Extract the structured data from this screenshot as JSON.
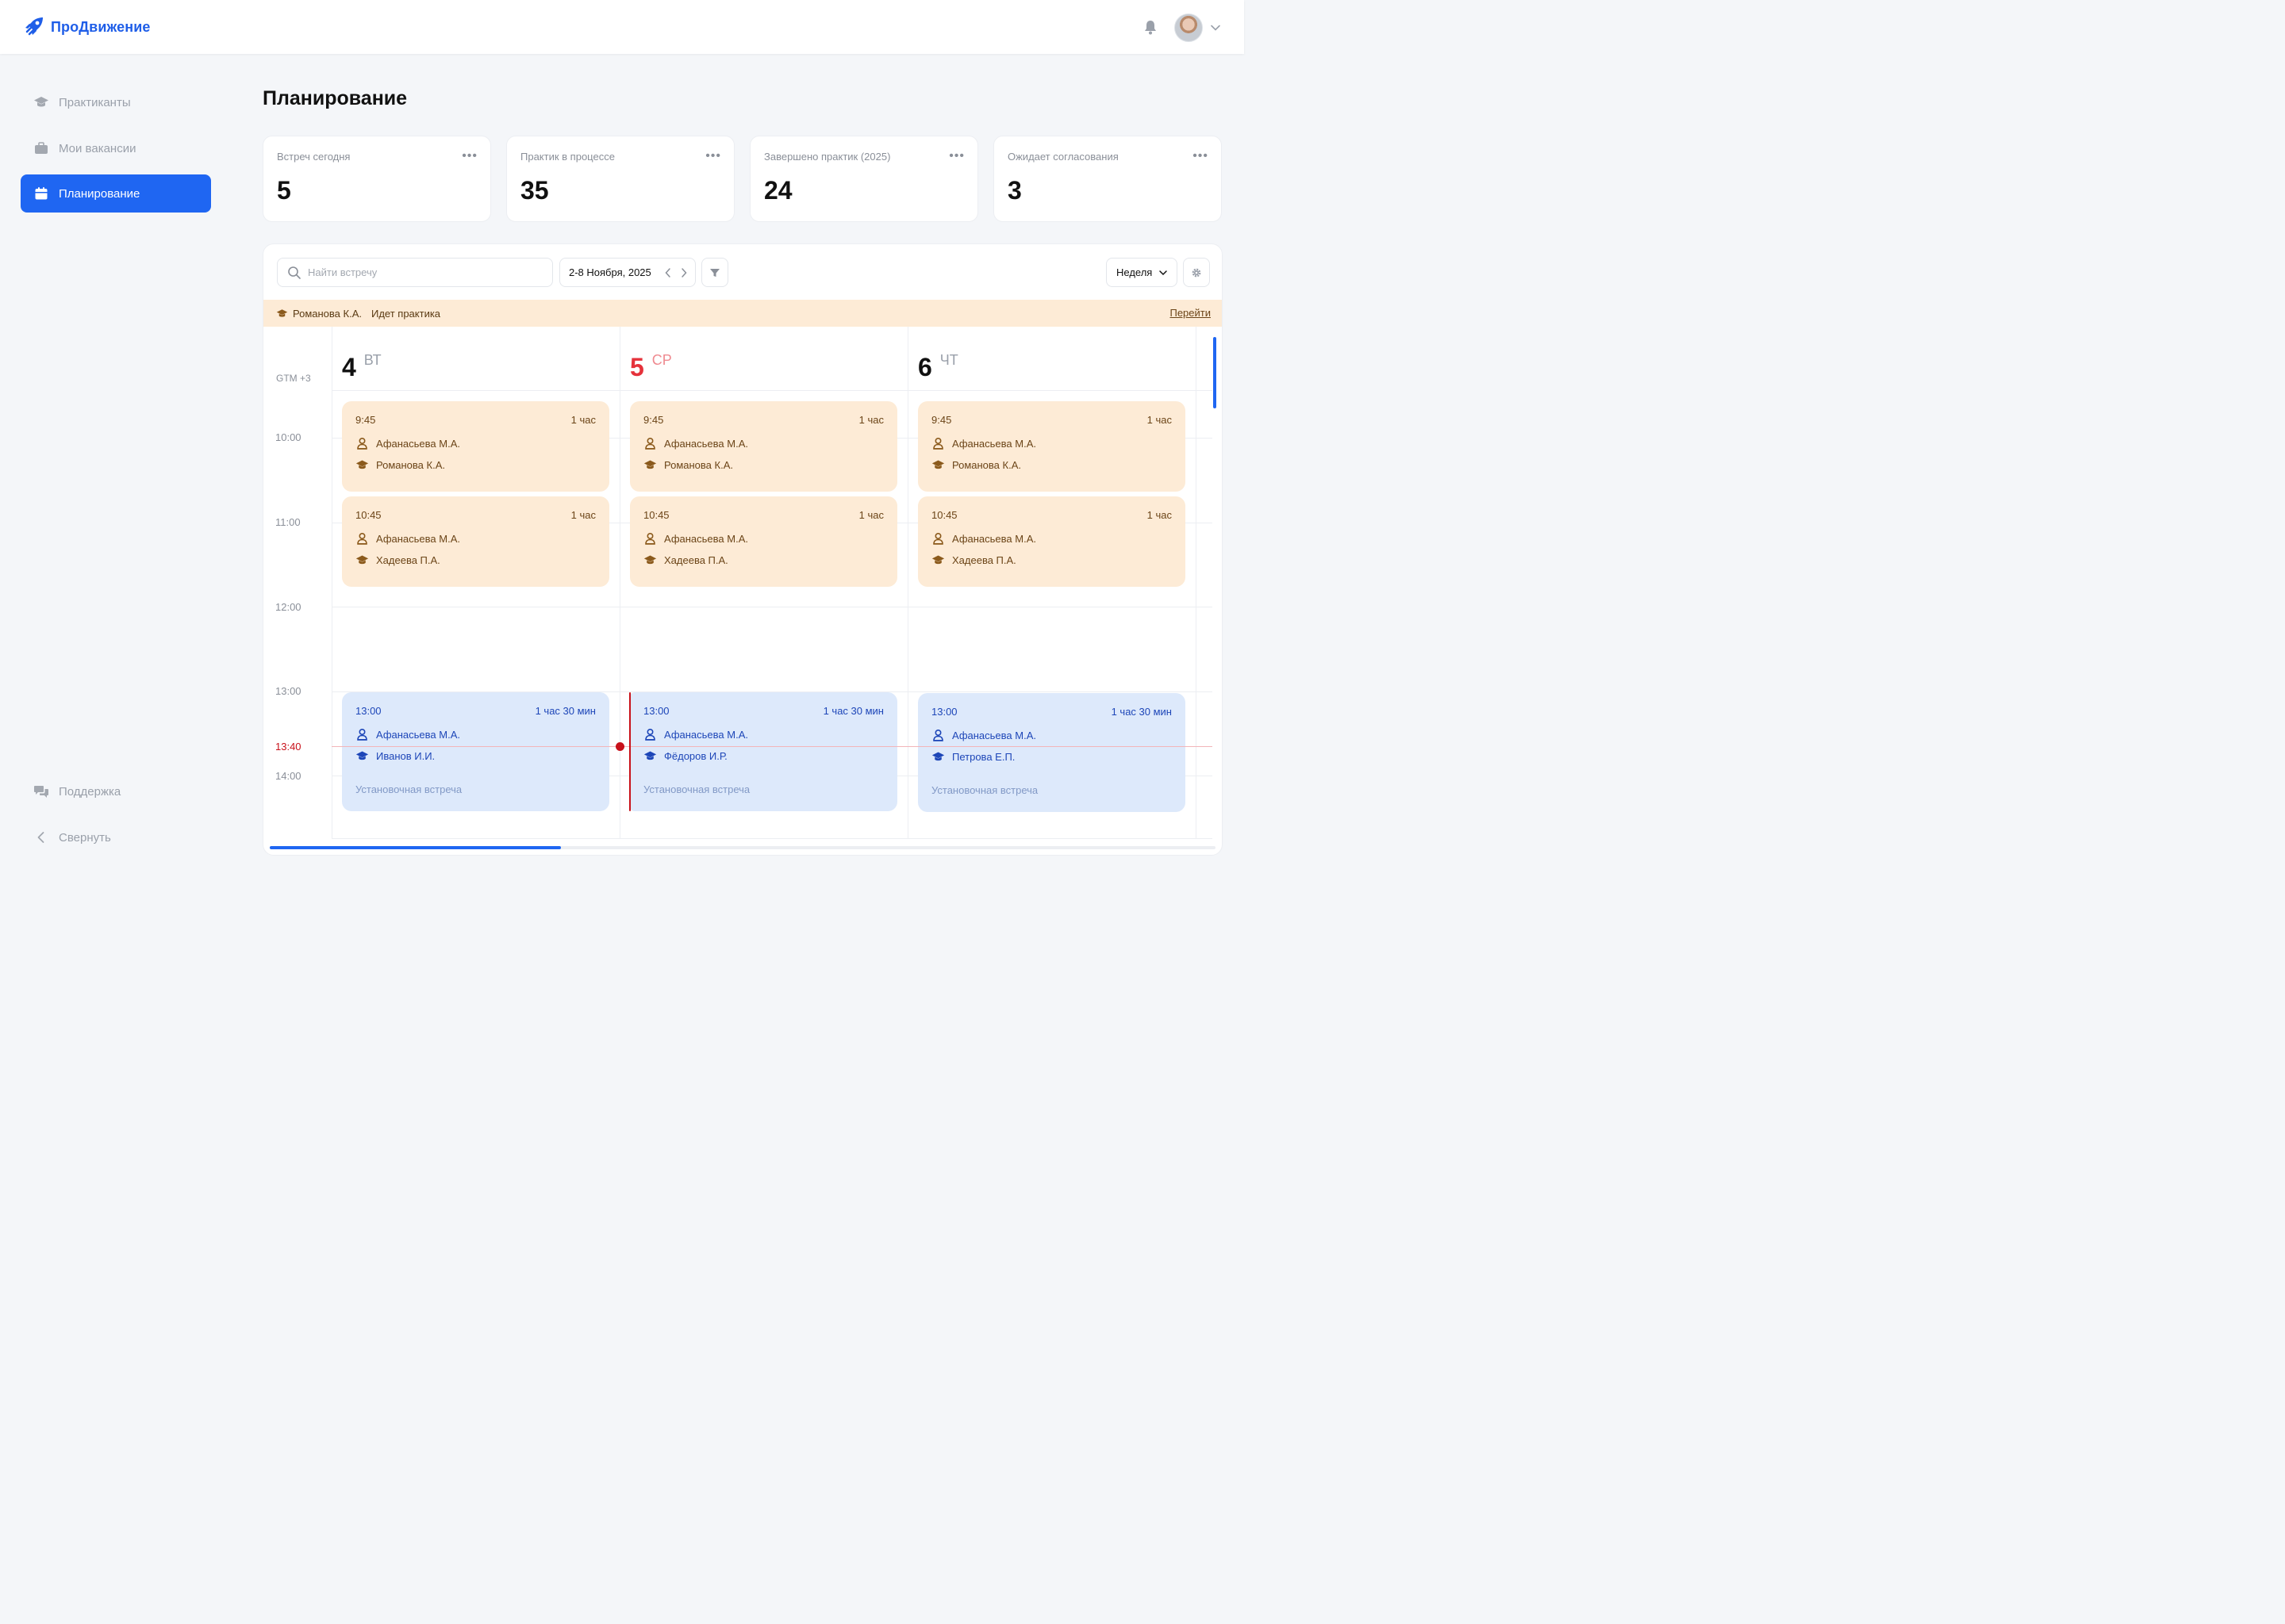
{
  "app": {
    "name": "ПроДвижение",
    "brand_color": "#1f5ee8"
  },
  "sidebar": {
    "items": [
      {
        "label": "Практиканты",
        "icon": "graduation-cap-icon"
      },
      {
        "label": "Мои вакансии",
        "icon": "briefcase-icon"
      },
      {
        "label": "Планирование",
        "icon": "calendar-icon",
        "active": true
      }
    ],
    "support_label": "Поддержка",
    "collapse_label": "Свернуть"
  },
  "page": {
    "title": "Планирование"
  },
  "stats": [
    {
      "label": "Встреч сегодня",
      "value": "5"
    },
    {
      "label": "Практик в процессе",
      "value": "35"
    },
    {
      "label": "Завершено практик (2025)",
      "value": "24"
    },
    {
      "label": "Ожидает согласования",
      "value": "3"
    }
  ],
  "toolbar": {
    "search_placeholder": "Найти встречу",
    "date_range": "2-8 Ноября, 2025",
    "view": "Неделя"
  },
  "banner": {
    "name": "Романова К.А.",
    "status": "Идет практика",
    "link": "Перейти"
  },
  "calendar": {
    "timezone": "GTM +3",
    "times": [
      "10:00",
      "11:00",
      "12:00",
      "13:00",
      "14:00"
    ],
    "now": "13:40",
    "days": [
      {
        "num": "4",
        "wd": "ВТ"
      },
      {
        "num": "5",
        "wd": "СР",
        "today": true
      },
      {
        "num": "6",
        "wd": "ЧТ"
      }
    ],
    "events": [
      [
        {
          "time": "9:45",
          "duration": "1 час",
          "mentor": "Афанасьева М.А.",
          "intern": "Романова К.А."
        },
        {
          "time": "10:45",
          "duration": "1 час",
          "mentor": "Афанасьева М.А.",
          "intern": "Хадеева П.А."
        },
        {
          "time": "13:00",
          "duration": "1 час 30 мин",
          "mentor": "Афанасьева М.А.",
          "intern": "Иванов И.И.",
          "note": "Установочная встреча"
        }
      ],
      [
        {
          "time": "9:45",
          "duration": "1 час",
          "mentor": "Афанасьева М.А.",
          "intern": "Романова К.А."
        },
        {
          "time": "10:45",
          "duration": "1 час",
          "mentor": "Афанасьева М.А.",
          "intern": "Хадеева П.А."
        },
        {
          "time": "13:00",
          "duration": "1 час 30 мин",
          "mentor": "Афанасьева М.А.",
          "intern": "Фёдоров И.Р.",
          "note": "Установочная встреча"
        }
      ],
      [
        {
          "time": "9:45",
          "duration": "1 час",
          "mentor": "Афанасьева М.А.",
          "intern": "Романова К.А."
        },
        {
          "time": "10:45",
          "duration": "1 час",
          "mentor": "Афанасьева М.А.",
          "intern": "Хадеева П.А."
        },
        {
          "time": "13:00",
          "duration": "1 час 30 мин",
          "mentor": "Афанасьева М.А.",
          "intern": "Петрова Е.П.",
          "note": "Установочная встреча"
        }
      ]
    ]
  },
  "colors": {
    "active": "#1f66f2",
    "today": "#e5323b",
    "now_line": "#c8111a",
    "orange_event": "#fdebd6",
    "blue_event": "#dde9fb"
  }
}
